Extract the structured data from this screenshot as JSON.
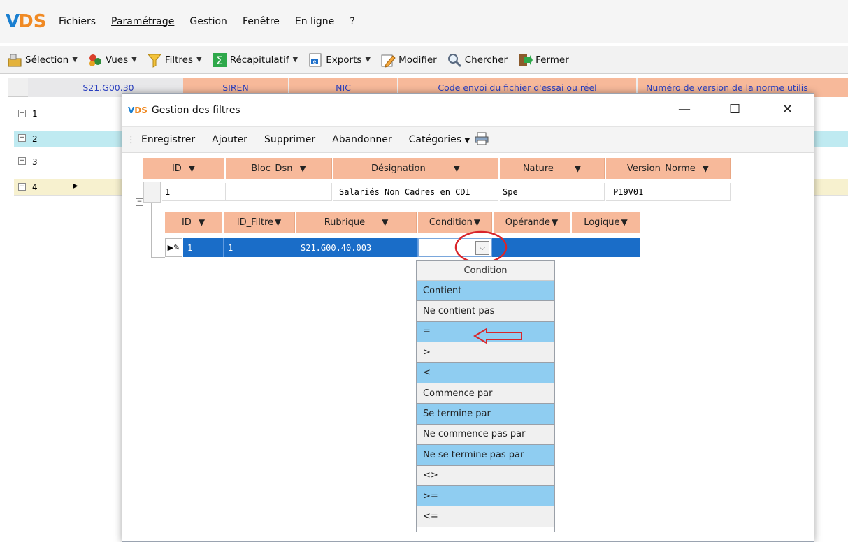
{
  "menubar": {
    "logo": {
      "v": "V",
      "s": "DS"
    },
    "items": [
      "Fichiers",
      "Paramétrage",
      "Gestion",
      "Fenêtre",
      "En ligne",
      "?"
    ]
  },
  "toolbar": {
    "items": [
      {
        "label": "Sélection",
        "dropdown": true,
        "icon": "selection-icon"
      },
      {
        "label": "Vues",
        "dropdown": true,
        "icon": "views-icon"
      },
      {
        "label": "Filtres",
        "dropdown": true,
        "icon": "filter-icon"
      },
      {
        "label": "Récapitulatif",
        "dropdown": true,
        "icon": "sum-icon"
      },
      {
        "label": "Exports",
        "dropdown": true,
        "icon": "export-icon"
      },
      {
        "label": "Modifier",
        "dropdown": false,
        "icon": "edit-icon"
      },
      {
        "label": "Chercher",
        "dropdown": false,
        "icon": "search-icon"
      },
      {
        "label": "Fermer",
        "dropdown": false,
        "icon": "close-door-icon"
      }
    ]
  },
  "background_grid": {
    "columns": [
      "S21.G00.30",
      "SIREN",
      "NIC",
      "Code envoi du fichier d'essai ou réel",
      "Numéro de version de la norme utilis"
    ],
    "rows": [
      "1",
      "2",
      "3",
      "4"
    ]
  },
  "dialog": {
    "title": "Gestion des filtres",
    "logo": {
      "v": "V",
      "s": "DS"
    },
    "controls": {
      "minimize": "—",
      "maximize": "☐",
      "close": "✕"
    },
    "toolbar": [
      "Enregistrer",
      "Ajouter",
      "Supprimer",
      "Abandonner",
      "Catégories"
    ],
    "filters_grid": {
      "columns": [
        "ID",
        "Bloc_Dsn",
        "Désignation",
        "Nature",
        "Version_Norme"
      ],
      "rows": [
        {
          "ID": "1",
          "Bloc_Dsn": "",
          "Désignation": "Salariés Non Cadres en CDI",
          "Nature": "Spe",
          "Version_Norme": "P19V01"
        }
      ]
    },
    "conditions_grid": {
      "columns": [
        "ID",
        "ID_Filtre",
        "Rubrique",
        "Condition",
        "Opérande",
        "Logique"
      ],
      "rows": [
        {
          "ID": "1",
          "ID_Filtre": "1",
          "Rubrique": "S21.G00.40.003",
          "Condition": "",
          "Opérande": "",
          "Logique": ""
        }
      ]
    },
    "condition_dropdown": {
      "title": "Condition",
      "options": [
        "Contient",
        "Ne contient pas",
        "=",
        ">",
        "<",
        "Commence par",
        "Se termine par",
        "Ne commence pas par",
        "Ne se termine pas par",
        "<>",
        ">=",
        "<="
      ]
    }
  },
  "colors": {
    "header_peach": "#f7b99a",
    "selected_row": "#1a6dc8",
    "dropdown_blue": "#8fcdf1",
    "annotation_red": "#d9252a"
  }
}
